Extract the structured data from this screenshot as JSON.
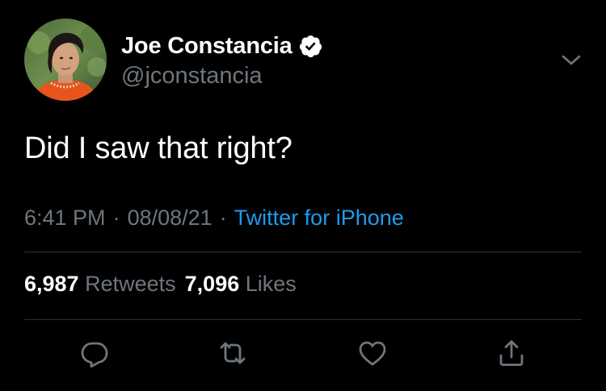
{
  "tweet": {
    "author": {
      "display_name": "Joe Constancia",
      "handle": "@jconstancia",
      "verified": true
    },
    "text": "Did I saw that right?",
    "time": "6:41 PM",
    "date": "08/08/21",
    "source": "Twitter for iPhone",
    "separator": "·"
  },
  "stats": {
    "retweets_count": "6,987",
    "retweets_label": "Retweets",
    "likes_count": "7,096",
    "likes_label": "Likes"
  },
  "icons": {
    "verified": "verified-badge-icon",
    "more": "chevron-down-icon",
    "reply": "reply-icon",
    "retweet": "retweet-icon",
    "like": "heart-icon",
    "share": "share-icon"
  },
  "colors": {
    "background": "#000000",
    "text": "#ffffff",
    "secondary_text": "#6e767d",
    "link": "#1d9bf0",
    "divider": "#2f3336"
  }
}
